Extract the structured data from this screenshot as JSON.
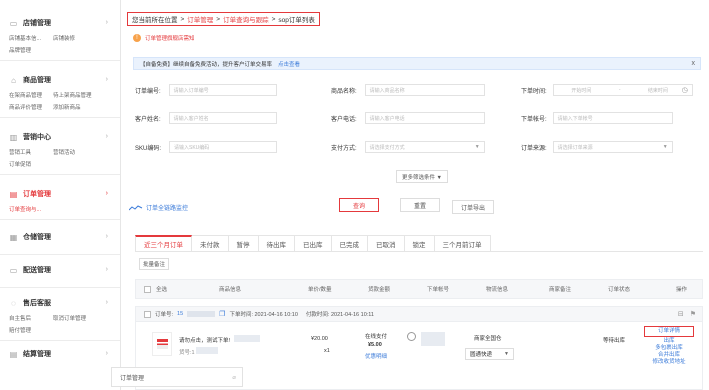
{
  "sidebar": {
    "sections": [
      {
        "icon": "store-icon",
        "glyph": "▭",
        "title": "店铺管理",
        "links": [
          "店铺基本信...",
          "店铺装修",
          "品牌管理"
        ]
      },
      {
        "icon": "product-icon",
        "glyph": "⌂",
        "title": "商品管理",
        "links": [
          "在架商品管理",
          "待上架商品管理",
          "商品评价管理",
          "添加新商品"
        ]
      },
      {
        "icon": "marketing-icon",
        "glyph": "▥",
        "title": "营销中心",
        "links": [
          "营销工具",
          "营销活动",
          "订单促销"
        ]
      },
      {
        "icon": "order-icon",
        "glyph": "▤",
        "title": "订单管理",
        "links": [
          "订单查询与..."
        ]
      },
      {
        "icon": "warehouse-icon",
        "glyph": "▦",
        "title": "仓储管理",
        "links": []
      },
      {
        "icon": "delivery-icon",
        "glyph": "▭",
        "title": "配送管理",
        "links": []
      },
      {
        "icon": "service-icon",
        "glyph": "◌",
        "title": "售后客服",
        "links": [
          "自主售后",
          "取消订单管理",
          "赔付管理"
        ]
      },
      {
        "icon": "settlement-icon",
        "glyph": "▤",
        "title": "结算管理",
        "links": []
      }
    ]
  },
  "breadcrumb": {
    "prefix": "您当前所在位置",
    "sep": ">",
    "level1": "订单管理",
    "level2": "订单查询与跟踪",
    "level3": "sop订单列表"
  },
  "help": {
    "icon": "!",
    "label": "订单管理旗舰店需知"
  },
  "notice": {
    "text": "【自备免费】继续自备免费活动，提升客户订单交易率",
    "link": "点击查看",
    "close": "x"
  },
  "filters": {
    "order_no": {
      "label": "订单编号:",
      "placeholder": "请输入订单编号"
    },
    "product_name": {
      "label": "商品名称:",
      "placeholder": "请输入商品名称"
    },
    "order_time": {
      "label": "下单时间:",
      "start": "开始时间",
      "dash": "-",
      "end": "结束时间",
      "icon": "◷"
    },
    "customer_name": {
      "label": "客户姓名:",
      "placeholder": "请输入客户姓名"
    },
    "customer_phone": {
      "label": "客户电话:",
      "placeholder": "请输入客户电话"
    },
    "account": {
      "label": "下单帐号:",
      "placeholder": "请输入下单帐号"
    },
    "sku": {
      "label": "SKU编码:",
      "placeholder": "请输入SKU编码"
    },
    "payment": {
      "label": "支付方式:",
      "placeholder": "请选择支付方式"
    },
    "source": {
      "label": "订单来源:",
      "placeholder": "请选择订单来源"
    },
    "dd_arrow": "▼",
    "more": "更多筛选条件 ▼"
  },
  "actions": {
    "monitor": "订单全链路监控",
    "query": "查询",
    "reset": "重置",
    "export": "订单导出"
  },
  "tabs": [
    "近三个月订单",
    "未付款",
    "暂停",
    "待出库",
    "已出库",
    "已完成",
    "已取消",
    "锁定",
    "三个月前订单"
  ],
  "batch": "批量备注",
  "table": {
    "all": "全选",
    "columns": [
      "商品信息",
      "单价/数量",
      "货款金额",
      "下单帐号",
      "物流信息",
      "商家备注",
      "订单状态",
      "操作"
    ]
  },
  "order": {
    "no_label": "订单号:",
    "no_value": "15",
    "order_time": "下单时间: 2021-04-16 10:10",
    "pay_time": "付款时间: 2021-04-16 10:11",
    "product": "请勿点击，测试下单!",
    "product_sub": "货号:1",
    "price": "¥20.00",
    "qty": "x1",
    "pay_type": "在线支付",
    "amount": "¥5.00",
    "amount_link": "优惠明细",
    "logistics": "商家全国仓",
    "express": "圆通快递",
    "status": "等待出库",
    "ops": [
      "订单详情",
      "出库",
      "多包裹出库",
      "合并出库",
      "修改收货地址"
    ]
  },
  "bottom_tab": {
    "label": "订单管理",
    "pin": "⌀"
  }
}
